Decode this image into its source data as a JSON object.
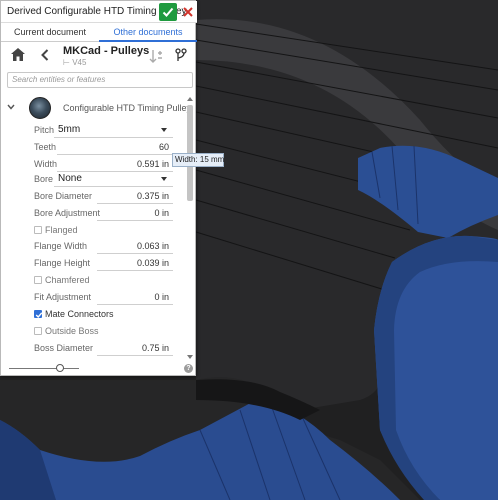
{
  "panel": {
    "title": "Derived Configurable HTD Timing Pulley",
    "tabs": [
      "Current document",
      "Other documents"
    ],
    "active_tab": 1,
    "document": {
      "name": "MKCad - Pulleys",
      "version": "V45"
    },
    "search_placeholder": "Search entities or features",
    "part_name": "Configurable HTD Timing Pulley",
    "fields": {
      "pitch": {
        "label": "Pitch",
        "value": "5mm"
      },
      "teeth": {
        "label": "Teeth",
        "value": "60"
      },
      "width": {
        "label": "Width",
        "value": "0.591 in"
      },
      "bore": {
        "label": "Bore",
        "value": "None"
      },
      "bore_diameter": {
        "label": "Bore Diameter",
        "value": "0.375 in"
      },
      "bore_adjustment": {
        "label": "Bore Adjustment",
        "value": "0 in"
      },
      "flanged": {
        "label": "Flanged",
        "checked": false
      },
      "flange_width": {
        "label": "Flange Width",
        "value": "0.063 in"
      },
      "flange_height": {
        "label": "Flange Height",
        "value": "0.039 in"
      },
      "chamfered": {
        "label": "Chamfered",
        "checked": false
      },
      "fit_adjustment": {
        "label": "Fit Adjustment",
        "value": "0 in"
      },
      "mate_connectors": {
        "label": "Mate Connectors",
        "checked": true
      },
      "outside_boss": {
        "label": "Outside Boss",
        "checked": false
      },
      "boss_diameter": {
        "label": "Boss Diameter",
        "value": "0.75 in"
      }
    },
    "help_glyph": "?",
    "slider_level": 0.7
  },
  "tooltip": {
    "text": "Width: 15 mm"
  },
  "colors": {
    "accent": "#2f6fd6",
    "ok": "#1f9a3f",
    "part_blue": "#2a4c90"
  },
  "icons": [
    "check-icon",
    "close-icon",
    "home-icon",
    "back-arrow-icon",
    "insert-icon",
    "branch-icon",
    "chevron-down-icon",
    "help-icon"
  ]
}
